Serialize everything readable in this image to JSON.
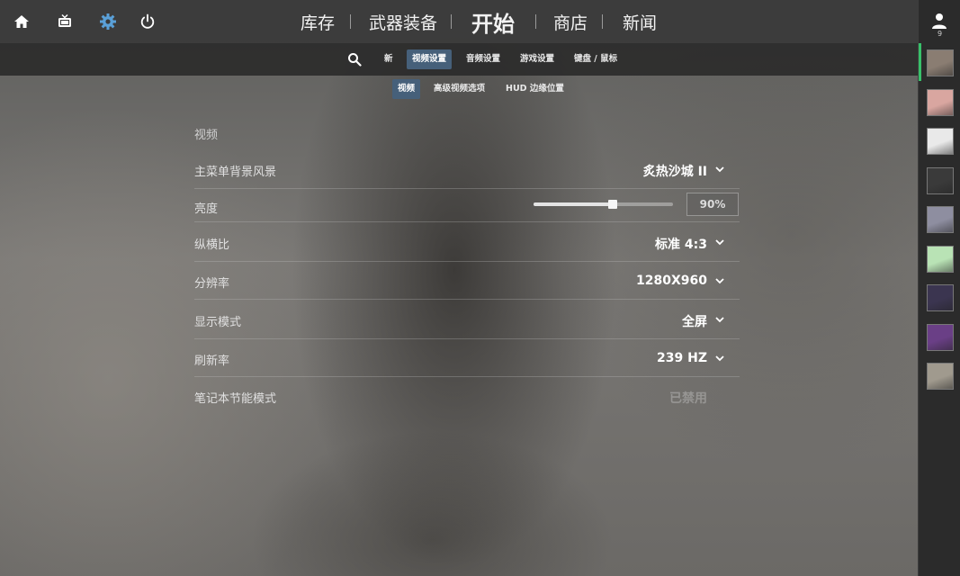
{
  "topnav": {
    "items": [
      "库存",
      "武器装备",
      "开始",
      "商店",
      "新闻"
    ]
  },
  "settings_tabs": {
    "items": [
      "新",
      "视频设置",
      "音频设置",
      "游戏设置",
      "键盘 / 鼠标"
    ],
    "active": "视频设置"
  },
  "video_subtabs": {
    "items": [
      "视频",
      "高级视频选项",
      "HUD 边缘位置"
    ],
    "active": "视频"
  },
  "panel": {
    "section_title": "视频",
    "rows": {
      "background": {
        "label": "主菜单背景风景",
        "value": "炙热沙城 II"
      },
      "brightness": {
        "label": "亮度",
        "value": "90%",
        "level_fraction": 0.57
      },
      "aspect": {
        "label": "纵横比",
        "value": "标准 4:3"
      },
      "resolution": {
        "label": "分辨率",
        "value": "1280X960"
      },
      "display_mode": {
        "label": "显示模式",
        "value": "全屏"
      },
      "refresh_rate": {
        "label": "刷新率",
        "value": "239 HZ"
      },
      "laptop_power": {
        "label": "笔记本节能模式",
        "value": "已禁用"
      }
    }
  },
  "friends": {
    "online_count": "9",
    "avatar_colors": [
      "#8a7d72",
      "#d9a6a0",
      "#e9e9e9",
      "#3a3a3a",
      "#8e8ea0",
      "#b9e3b5",
      "#3b3550",
      "#6a3f86",
      "#a09a8e"
    ]
  },
  "colors": {
    "accent_tab": "#46607a",
    "settings_icon": "#5aa0d8",
    "active_friend": "#38c06a"
  }
}
